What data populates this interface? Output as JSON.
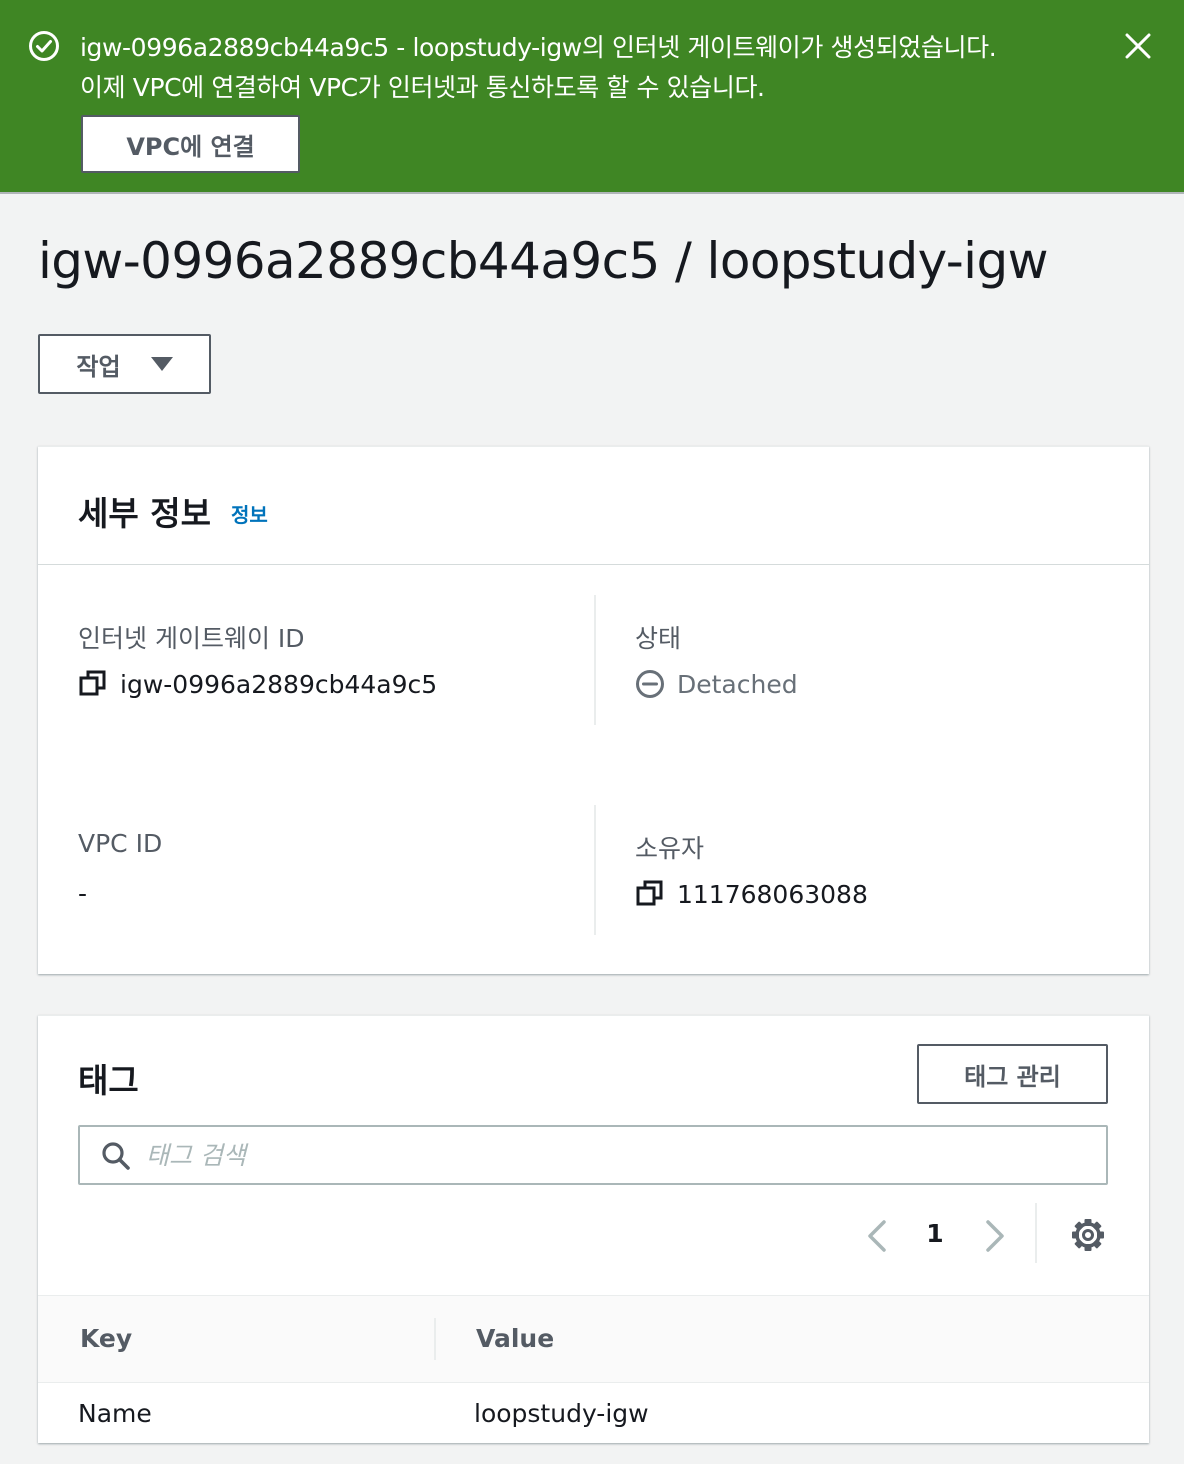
{
  "flash": {
    "message_line1": "igw-0996a2889cb44a9c5 - loopstudy-igw의 인터넷 게이트웨이가 생성되었습니다.",
    "message_line2": "이제 VPC에 연결하여 VPC가 인터넷과 통신하도록 할 수 있습니다.",
    "attach_button": "VPC에 연결",
    "success_color": "#3f8624",
    "icons": {
      "status": "check-circle-icon",
      "dismiss": "close-icon"
    }
  },
  "page": {
    "title": "igw-0996a2889cb44a9c5 / loopstudy-igw",
    "actions_button": "작업"
  },
  "details": {
    "heading": "세부 정보",
    "info_link": "정보",
    "igw_id_label": "인터넷 게이트웨이 ID",
    "igw_id_value": "igw-0996a2889cb44a9c5",
    "state_label": "상태",
    "state_value": "Detached",
    "vpc_id_label": "VPC ID",
    "vpc_id_value": "-",
    "owner_label": "소유자",
    "owner_value": "111768063088",
    "icons": {
      "copy": "copy-icon",
      "state": "minus-circle-icon"
    }
  },
  "tags": {
    "heading": "태그",
    "manage_button": "태그 관리",
    "search_placeholder": "태그 검색",
    "search_value": "",
    "pagination": {
      "current_page": "1"
    },
    "columns": {
      "key": "Key",
      "value": "Value"
    },
    "rows": [
      {
        "key": "Name",
        "value": "loopstudy-igw"
      }
    ],
    "icons": {
      "search": "search-icon",
      "prev": "chevron-left-icon",
      "next": "chevron-right-icon",
      "settings": "gear-icon"
    }
  }
}
